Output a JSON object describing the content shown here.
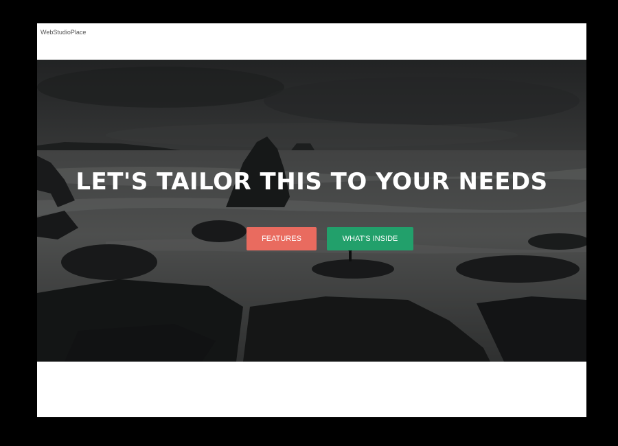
{
  "brand": {
    "name": "WebStudioPlace"
  },
  "hero": {
    "title": "LET'S TAILOR THIS TO YOUR NEEDS",
    "buttons": [
      {
        "label": "FEATURES",
        "color": "#e96b5f"
      },
      {
        "label": "WHAT'S INSIDE",
        "color": "#22a06b"
      }
    ],
    "overlay_color": "#1d1f20"
  }
}
